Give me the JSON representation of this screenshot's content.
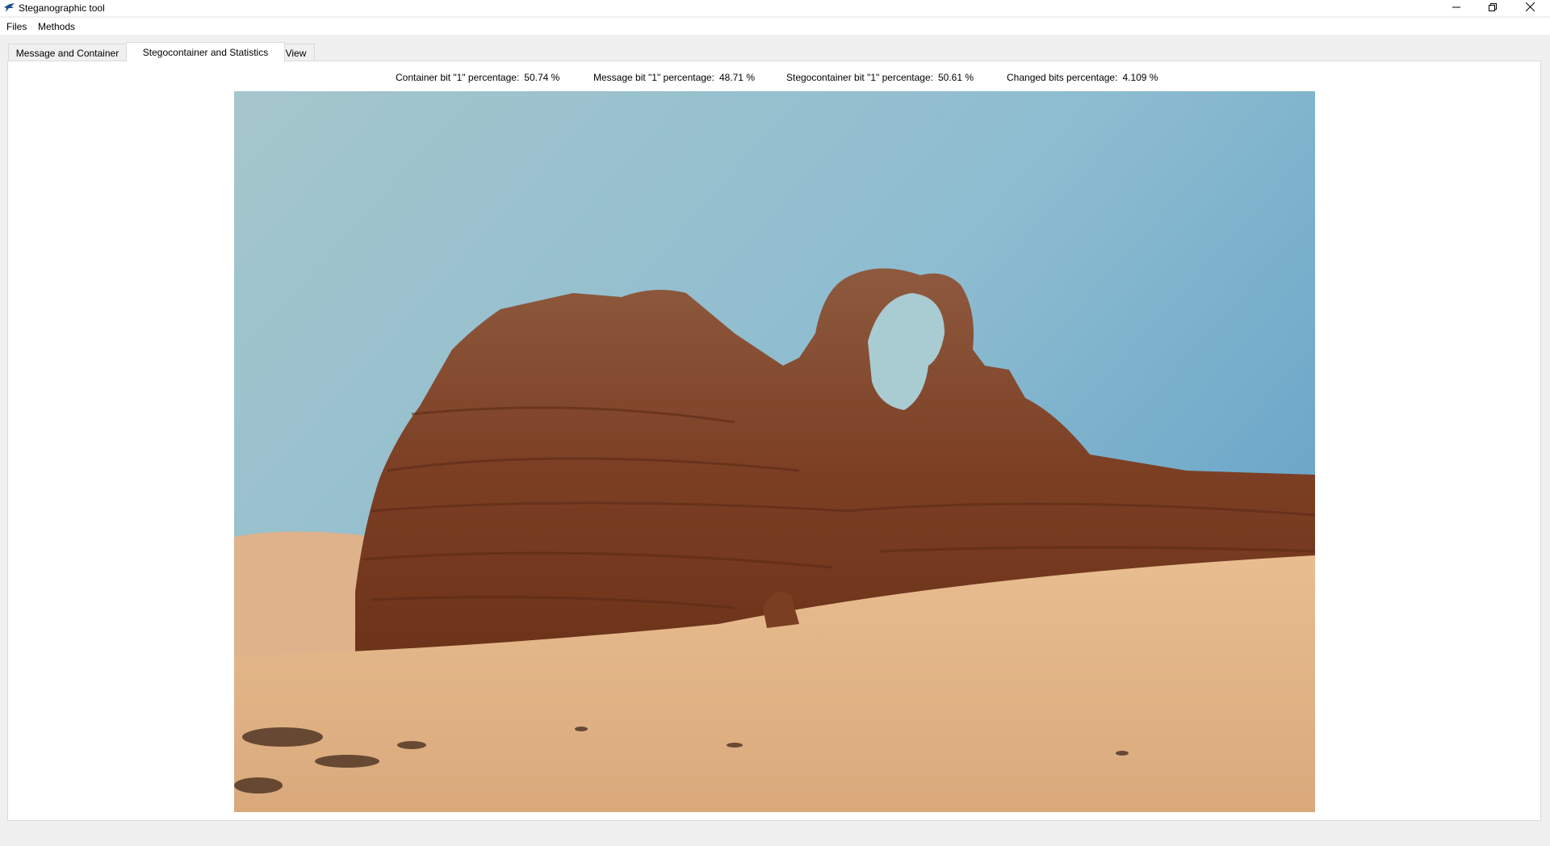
{
  "window": {
    "title": "Steganographic tool",
    "app_icon": "bird-icon",
    "controls": [
      "minimize-icon",
      "restore-icon",
      "close-icon"
    ]
  },
  "menu": {
    "files": "Files",
    "methods": "Methods"
  },
  "tabs": [
    {
      "label": "Message and Container",
      "active": false
    },
    {
      "label": "Stegocontainer and Statistics",
      "active": true
    },
    {
      "label": "View",
      "active": false
    }
  ],
  "stats": {
    "container_label": "Container bit \"1\" percentage:",
    "container_value": "50.74 %",
    "message_label": "Message bit \"1\" percentage:",
    "message_value": "48.71 %",
    "stego_label": "Stegocontainer bit \"1\" percentage:",
    "stego_value": "50.61 %",
    "changed_label": "Changed bits percentage:",
    "changed_value": "4.109 %"
  },
  "colors": {
    "sky_top": "#9ec2cc",
    "sky_right": "#6fa8c6",
    "rock": "#8a4a2a",
    "sand": "#e4b487"
  }
}
